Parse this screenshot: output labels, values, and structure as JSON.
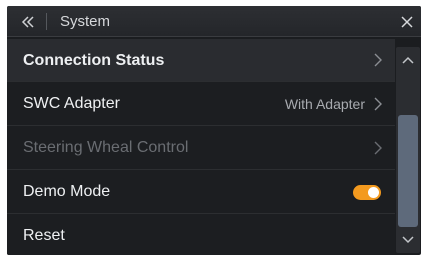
{
  "header": {
    "back_icon": "double-chevron-left-icon",
    "title": "System",
    "close_icon": "close-icon"
  },
  "settings": {
    "items": [
      {
        "label": "Connection Status",
        "value": "",
        "control": "chevron-right-icon",
        "enabled": true
      },
      {
        "label": "SWC Adapter",
        "value": "With Adapter",
        "control": "chevron-right-icon",
        "enabled": true
      },
      {
        "label": "Steering Wheal Control",
        "value": "",
        "control": "chevron-right-icon",
        "enabled": false
      },
      {
        "label": "Demo Mode",
        "value": "",
        "control": "toggle",
        "enabled": true,
        "toggle_on": true
      },
      {
        "label": "Reset",
        "value": "",
        "control": "",
        "enabled": true
      }
    ]
  },
  "scrollbar": {
    "up_icon": "chevron-up-icon",
    "down_icon": "chevron-down-icon"
  },
  "colors": {
    "background": "#1b1d20",
    "toggle_on": "#f39a1f",
    "scroll_thumb": "#5e6a7b"
  }
}
